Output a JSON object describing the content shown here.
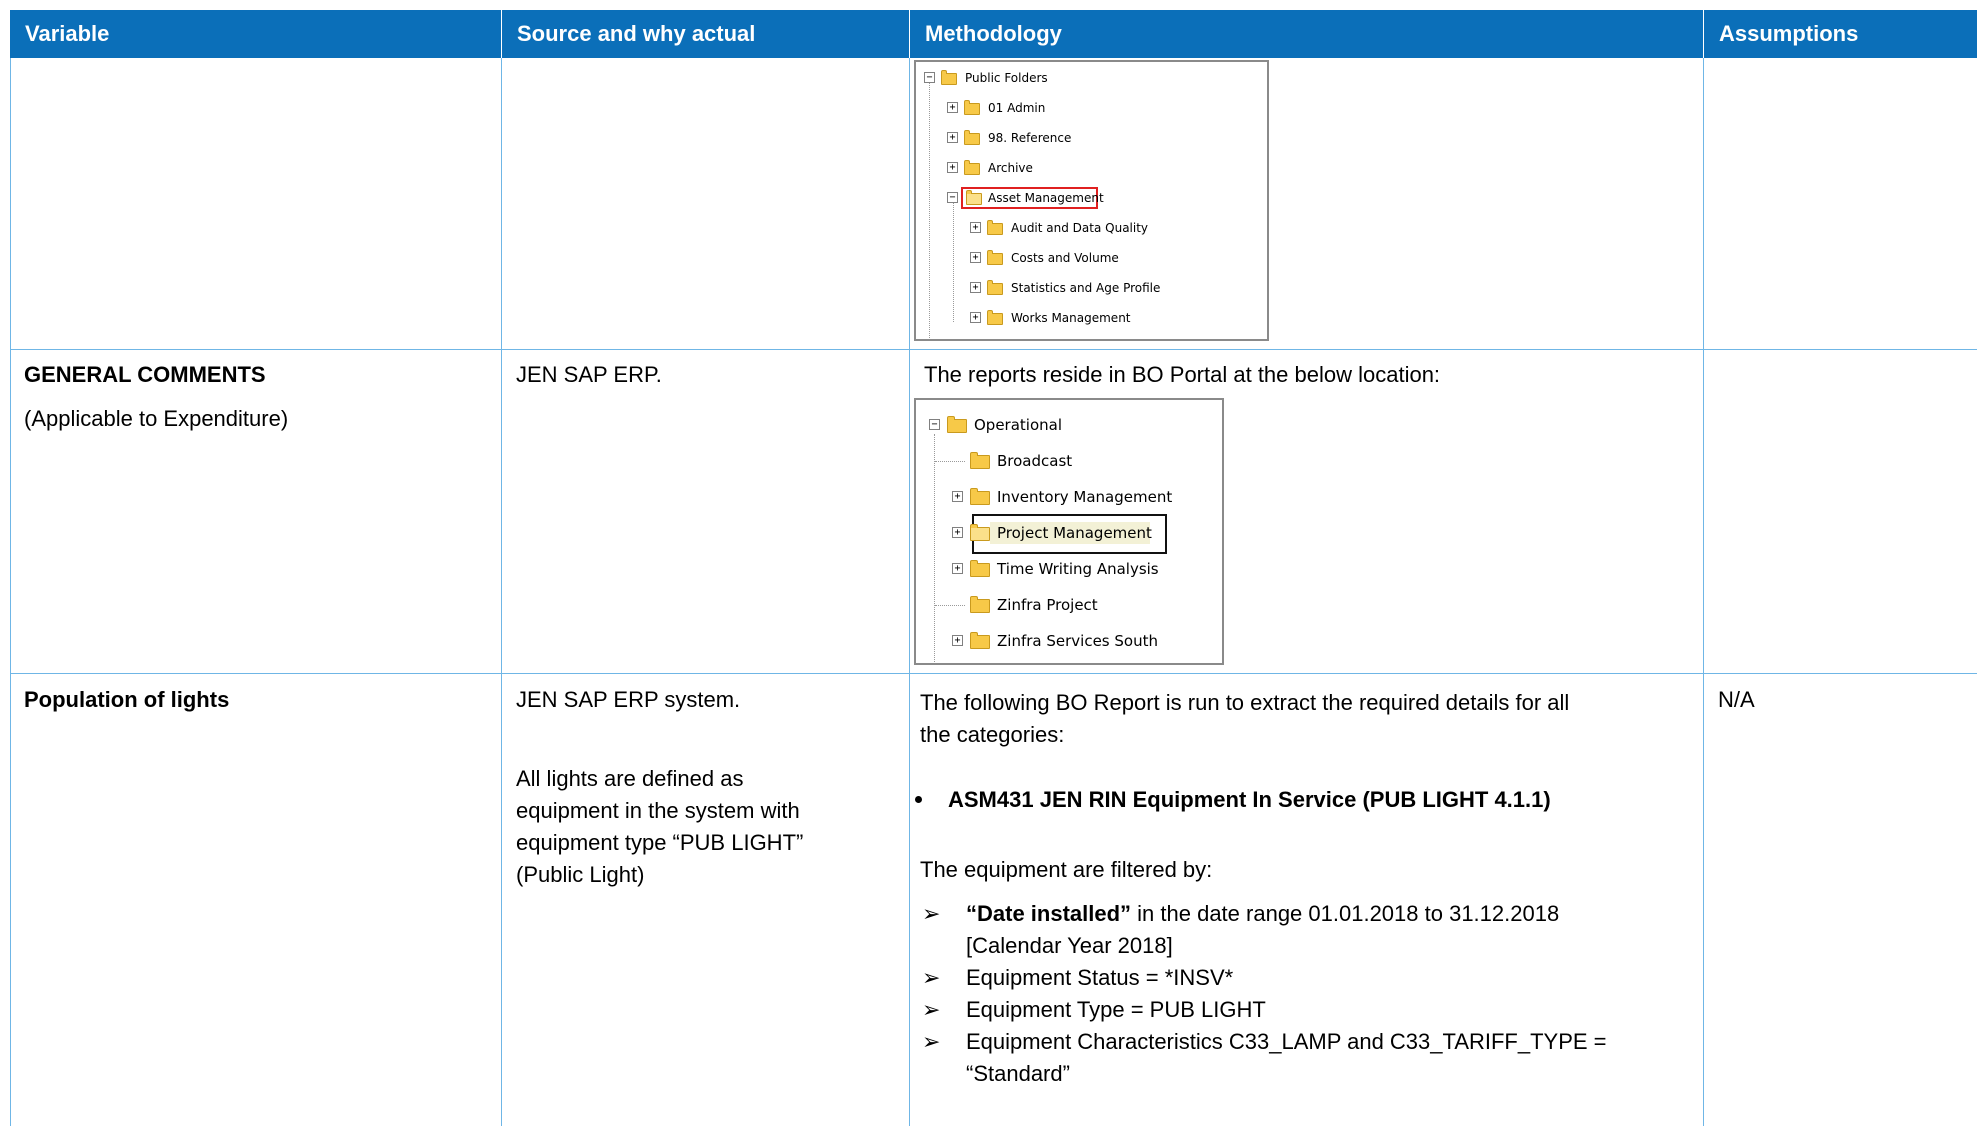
{
  "header": {
    "col1": "Variable",
    "col2": "Source and why actual",
    "col3": "Methodology",
    "col4": "Assumptions"
  },
  "tree1": {
    "root": "Public Folders",
    "items": [
      "01 Admin",
      "98. Reference",
      "Archive",
      "Asset Management"
    ],
    "children": [
      "Audit and Data Quality",
      "Costs and Volume",
      "Statistics and Age Profile",
      "Works Management"
    ]
  },
  "row2": {
    "variable_title": "GENERAL COMMENTS",
    "variable_sub": "(Applicable to Expenditure)",
    "source": "JEN SAP ERP.",
    "methodology_intro": "The reports reside in BO Portal at the below location:"
  },
  "tree2": {
    "root": "Operational",
    "items": [
      "Broadcast",
      "Inventory Management",
      "Project Management",
      "Time Writing Analysis",
      "Zinfra Project",
      "Zinfra Services South"
    ]
  },
  "row3": {
    "variable": "Population of lights",
    "source_line1": "JEN SAP ERP system.",
    "source_para": [
      "All lights are defined as",
      "equipment in the system with",
      "equipment type “PUB LIGHT”",
      "(Public Light)"
    ],
    "method_intro": [
      "The following BO Report is run to extract the required details for all",
      "the categories:"
    ],
    "report": "ASM431 JEN RIN Equipment In Service (PUB LIGHT 4.1.1)",
    "filter_intro": "The equipment are filtered by:",
    "filter1_bold": "“Date installed”",
    "filter1_rest": " in the date range 01.01.2018 to 31.12.2018",
    "filter1_cont": "[Calendar Year 2018]",
    "filter2": "Equipment Status = *INSV*",
    "filter3": "Equipment Type = PUB LIGHT",
    "filter4": "Equipment Characteristics C33_LAMP and C33_TARIFF_TYPE =",
    "filter4_cont": "“Standard”",
    "assumption": "N/A"
  }
}
